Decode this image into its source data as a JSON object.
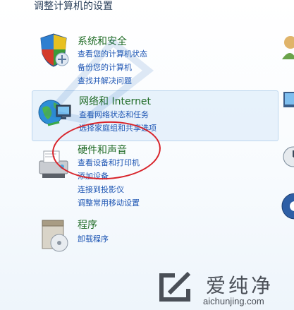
{
  "page": {
    "heading": "调整计算机的设置"
  },
  "categories": [
    {
      "id": "system-security",
      "title": "系统和安全",
      "links": [
        "查看您的计算机状态",
        "备份您的计算机",
        "查找并解决问题"
      ]
    },
    {
      "id": "network-internet",
      "title": "网络和 Internet",
      "links": [
        "查看网络状态和任务",
        "选择家庭组和共享选项"
      ]
    },
    {
      "id": "hardware-sound",
      "title": "硬件和声音",
      "links": [
        "查看设备和打印机",
        "添加设备",
        "连接到投影仪",
        "调整常用移动设置"
      ]
    },
    {
      "id": "programs",
      "title": "程序",
      "links": [
        "卸载程序"
      ]
    }
  ],
  "colors": {
    "category_title": "#1f6b25",
    "link": "#1d55b3",
    "highlight_circle": "#d8242b",
    "selected_bg": "#e0eefa"
  },
  "watermark": {
    "brand_name": "爱纯净",
    "brand_url": "aichunjing.com"
  }
}
